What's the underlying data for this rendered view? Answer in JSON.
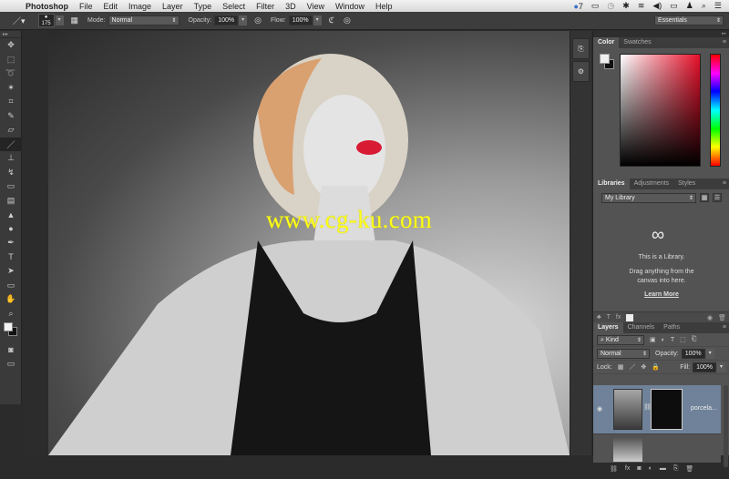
{
  "menubar": {
    "apple_icon": "",
    "app": "Photoshop",
    "items": [
      "File",
      "Edit",
      "Image",
      "Layer",
      "Type",
      "Select",
      "Filter",
      "3D",
      "View",
      "Window",
      "Help"
    ],
    "tray": {
      "cc_badge": "7",
      "airplay": "▭",
      "time_machine": "◷",
      "bluetooth": "✱",
      "wifi": "≋",
      "volume": "◀)",
      "battery": "▭",
      "user": "♟",
      "search": "⌕",
      "list": "☰"
    }
  },
  "options": {
    "tool_icon": "brush-icon",
    "brush_size": "175",
    "mode_label": "Mode:",
    "mode_value": "Normal",
    "opacity_label": "Opacity:",
    "opacity_value": "100%",
    "flow_label": "Flow:",
    "flow_value": "100%",
    "workspace": "Essentials"
  },
  "tools": [
    "move",
    "marquee",
    "lasso",
    "magic-wand",
    "crop",
    "eyedropper",
    "healing",
    "brush",
    "stamp",
    "history-brush",
    "eraser",
    "gradient",
    "blur",
    "dodge",
    "pen",
    "type",
    "path-select",
    "rectangle",
    "hand",
    "zoom"
  ],
  "tool_glyphs": [
    "✥",
    "⬚",
    "➰",
    "✶",
    "⌗",
    "✎",
    "▱",
    "／",
    "⊥",
    "↯",
    "▭",
    "▤",
    "▲",
    "●",
    "✒",
    "T",
    "➤",
    "▭",
    "✋",
    "⌕"
  ],
  "active_tool": "brush",
  "canvas": {
    "watermark": "www.cg-ku.com"
  },
  "color_panel": {
    "tabs": [
      "Color",
      "Swatches"
    ],
    "active_tab": "Color",
    "foreground": "#f0f0f0",
    "background": "#111111",
    "hue_color": "#e8102a"
  },
  "libraries_panel": {
    "tabs": [
      "Libraries",
      "Adjustments",
      "Styles"
    ],
    "active_tab": "Libraries",
    "library": "My Library",
    "message1": "This is a Library.",
    "message2": "Drag anything from the",
    "message3": "canvas into here.",
    "learn_more": "Learn More"
  },
  "layers_panel": {
    "tabs": [
      "Layers",
      "Channels",
      "Paths"
    ],
    "active_tab": "Layers",
    "filter": "Kind",
    "blend_mode": "Normal",
    "opacity_label": "Opacity:",
    "opacity": "100%",
    "lock_label": "Lock:",
    "fill_label": "Fill:",
    "fill": "100%",
    "layers": [
      {
        "name": "porcela...",
        "visible": true,
        "selected": true,
        "has_mask": true
      },
      {
        "name": "",
        "visible": false,
        "selected": false,
        "has_mask": false
      }
    ],
    "selected_color": "#6f8299"
  }
}
